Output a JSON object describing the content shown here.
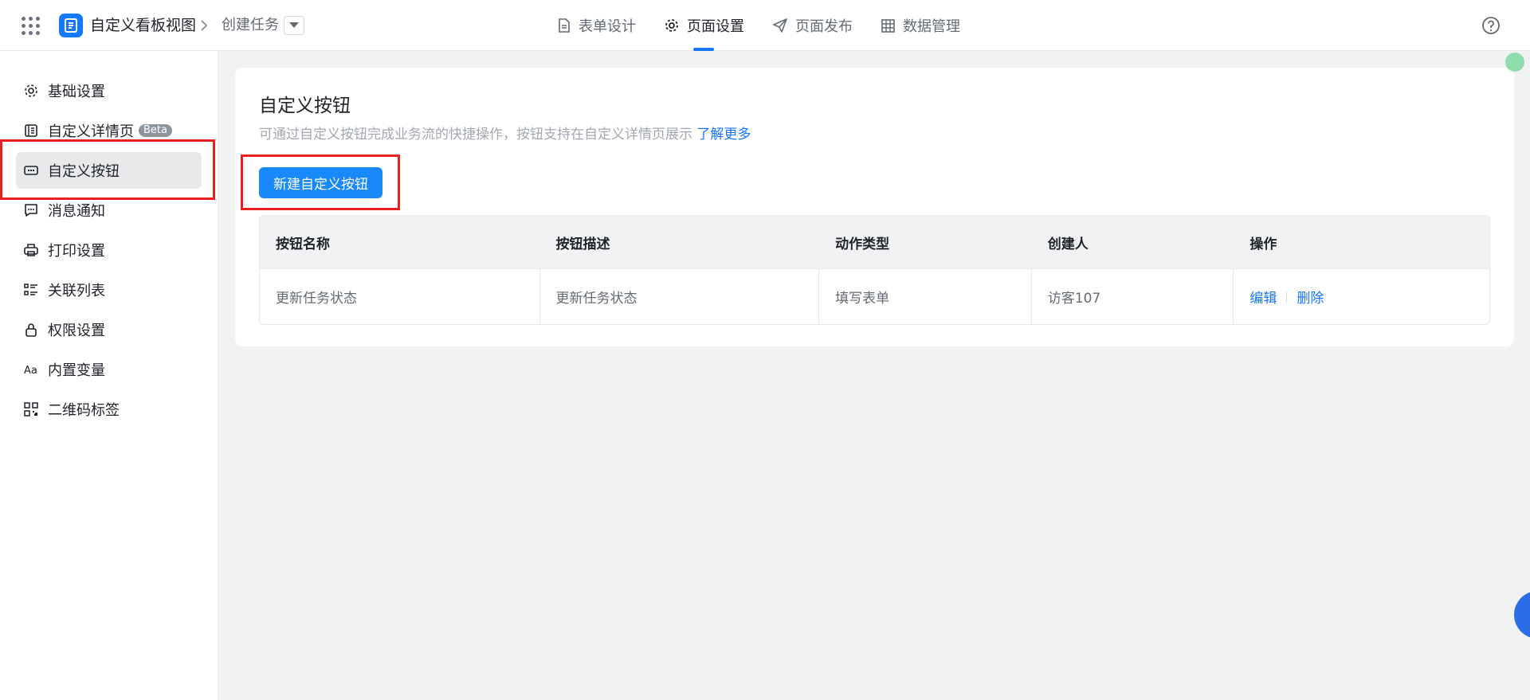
{
  "header": {
    "app_name": "自定义看板视图",
    "page_name": "创建任务",
    "tabs": [
      {
        "label": "表单设计",
        "icon": "document-icon"
      },
      {
        "label": "页面设置",
        "icon": "gear-icon",
        "active": true
      },
      {
        "label": "页面发布",
        "icon": "send-icon"
      },
      {
        "label": "数据管理",
        "icon": "table-icon"
      }
    ]
  },
  "sidebar": {
    "items": [
      {
        "label": "基础设置",
        "icon": "gear-icon"
      },
      {
        "label": "自定义详情页",
        "icon": "detail-page-icon",
        "badge": "Beta"
      },
      {
        "label": "自定义按钮",
        "icon": "button-icon",
        "active": true
      },
      {
        "label": "消息通知",
        "icon": "message-icon"
      },
      {
        "label": "打印设置",
        "icon": "printer-icon"
      },
      {
        "label": "关联列表",
        "icon": "list-icon"
      },
      {
        "label": "权限设置",
        "icon": "lock-icon"
      },
      {
        "label": "内置变量",
        "icon": "text-icon"
      },
      {
        "label": "二维码标签",
        "icon": "qrcode-icon"
      }
    ]
  },
  "main": {
    "title": "自定义按钮",
    "description": "可通过自定义按钮完成业务流的快捷操作，按钮支持在自定义详情页展示",
    "learn_more": "了解更多",
    "new_button": "新建自定义按钮",
    "table": {
      "columns": [
        "按钮名称",
        "按钮描述",
        "动作类型",
        "创建人",
        "操作"
      ],
      "rows": [
        {
          "name": "更新任务状态",
          "description": "更新任务状态",
          "action_type": "填写表单",
          "creator": "访客107",
          "edit": "编辑",
          "delete": "删除"
        }
      ]
    }
  },
  "colors": {
    "accent": "#1677ff",
    "primary_button": "#1989fa",
    "highlight_box": "#e8201f"
  }
}
